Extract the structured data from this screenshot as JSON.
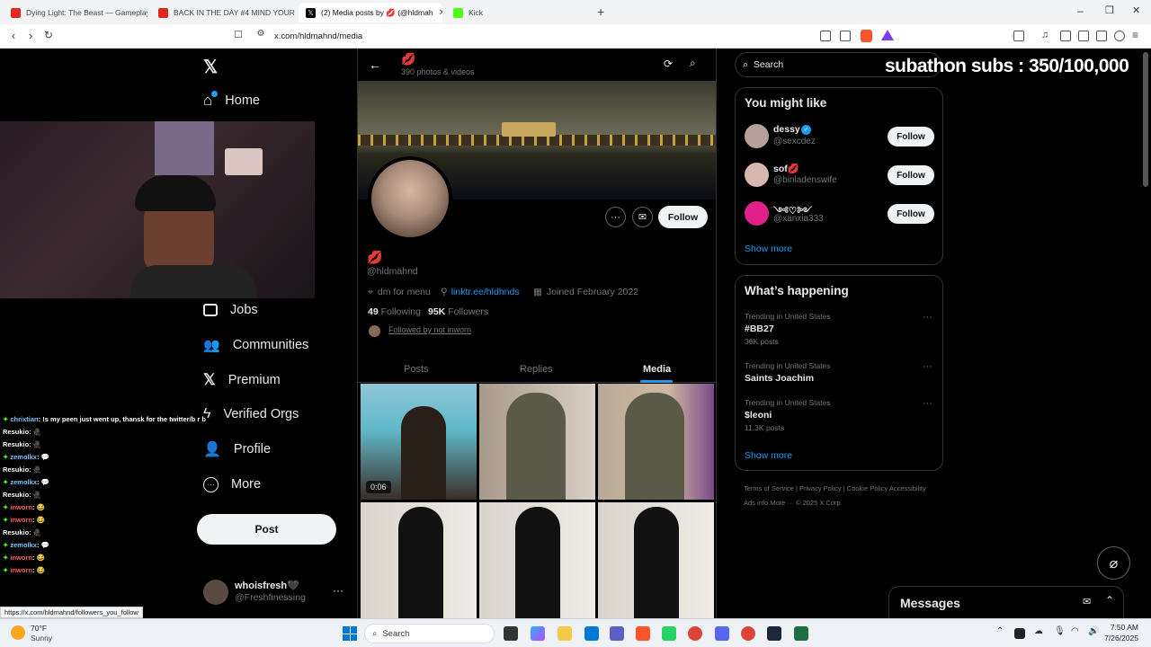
{
  "browser": {
    "tabs": [
      {
        "title": "Dying Light: The Beast — Gameplay",
        "color": "#e0281c"
      },
      {
        "title": "BACK IN THE DAY #4 MIND YOUR O",
        "color": "#e0281c"
      },
      {
        "title": "(2) Media posts by 💋 (@hldmah",
        "color": "#000000"
      },
      {
        "title": "Kick",
        "color": "#53fc18"
      }
    ],
    "url": "x.com/hldmahnd/media",
    "status_url": "https://x.com/hldmahnd/followers_you_follow"
  },
  "sidebar": {
    "items": [
      {
        "label": "Home",
        "icon": "home-icon"
      },
      {
        "label": "Jobs",
        "icon": "briefcase-icon"
      },
      {
        "label": "Communities",
        "icon": "people-icon"
      },
      {
        "label": "Premium",
        "icon": "x-logo-icon"
      },
      {
        "label": "Verified Orgs",
        "icon": "lightning-icon"
      },
      {
        "label": "Profile",
        "icon": "person-icon"
      },
      {
        "label": "More",
        "icon": "more-circle-icon"
      }
    ],
    "post_label": "Post",
    "account": {
      "name": "whoisfresh🖤",
      "handle": "@Freshfinessing"
    }
  },
  "chat": [
    {
      "user": "chrixtian",
      "msg": ": !s my peen just went up, thansk for the twitter/b r b",
      "color": "#7cc4ff"
    },
    {
      "user": "Resukio",
      "msg": ": 🥷🏿",
      "color": "#ffffff"
    },
    {
      "user": "Resukio",
      "msg": ": 🥷🏿",
      "color": "#ffffff"
    },
    {
      "user": "zemolkx",
      "msg": ": 💬",
      "color": "#7cc4ff"
    },
    {
      "user": "Resukio",
      "msg": ": 🥷🏿",
      "color": "#ffffff"
    },
    {
      "user": "zemolkx",
      "msg": ": 💬",
      "color": "#7cc4ff"
    },
    {
      "user": "Resukio",
      "msg": ": 🥷🏿",
      "color": "#ffffff"
    },
    {
      "user": "inworn",
      "msg": ": 😂",
      "color": "#ff5c5c"
    },
    {
      "user": "inworn",
      "msg": ": 😂",
      "color": "#ff5c5c"
    },
    {
      "user": "Resukio",
      "msg": ": 🥷🏿",
      "color": "#ffffff"
    },
    {
      "user": "zemolkx",
      "msg": ": 💬",
      "color": "#7cc4ff"
    },
    {
      "user": "inworn",
      "msg": ": 😂",
      "color": "#ff5c5c"
    },
    {
      "user": "inworn",
      "msg": ": 😂",
      "color": "#ff5c5c"
    }
  ],
  "profile": {
    "name": "💋",
    "post_count": "390 photos & videos",
    "handle": "@hldmahnd",
    "bio_location": "dm for menu",
    "link": "linktr.ee/hldhnds",
    "joined": "Joined February 2022",
    "following_count": "49",
    "following_label": "Following",
    "followers_count": "95K",
    "followers_label": "Followers",
    "followed_by": "Followed by not inworn",
    "follow_label": "Follow",
    "tabs": [
      "Posts",
      "Replies",
      "Media"
    ],
    "video_duration": "0:06"
  },
  "right": {
    "search_placeholder": "Search",
    "overlay": "subathon subs : 350/100,000",
    "might_like_title": "You might like",
    "suggestions": [
      {
        "name": "dessy",
        "handle": "@sexcdez",
        "follow": "Follow",
        "color": "#b8a09a"
      },
      {
        "name": "sof💋",
        "handle": "@binladenswife",
        "follow": "Follow",
        "color": "#d7b8b0"
      },
      {
        "name": "༺♡༻",
        "handle": "@xanxia333",
        "follow": "Follow",
        "color": "#e0218a"
      }
    ],
    "show_more": "Show more",
    "happening_title": "What’s happening",
    "trends": [
      {
        "context": "Trending in United States",
        "topic": "#BB27",
        "count": "36K posts"
      },
      {
        "context": "Trending in United States",
        "topic": "Saints Joachim",
        "count": ""
      },
      {
        "context": "Trending in United States",
        "topic": "$leoni",
        "count": "11.3K posts"
      }
    ],
    "footer": [
      "Terms of Service",
      "Privacy Policy",
      "Cookie Policy",
      "Accessibility",
      "Ads info",
      "More ···",
      "© 2025 X Corp."
    ],
    "messages_label": "Messages"
  },
  "taskbar": {
    "weather_temp": "70°F",
    "weather_text": "Sunny",
    "search_label": "Search",
    "time": "7:50 AM",
    "date": "7/26/2025"
  }
}
